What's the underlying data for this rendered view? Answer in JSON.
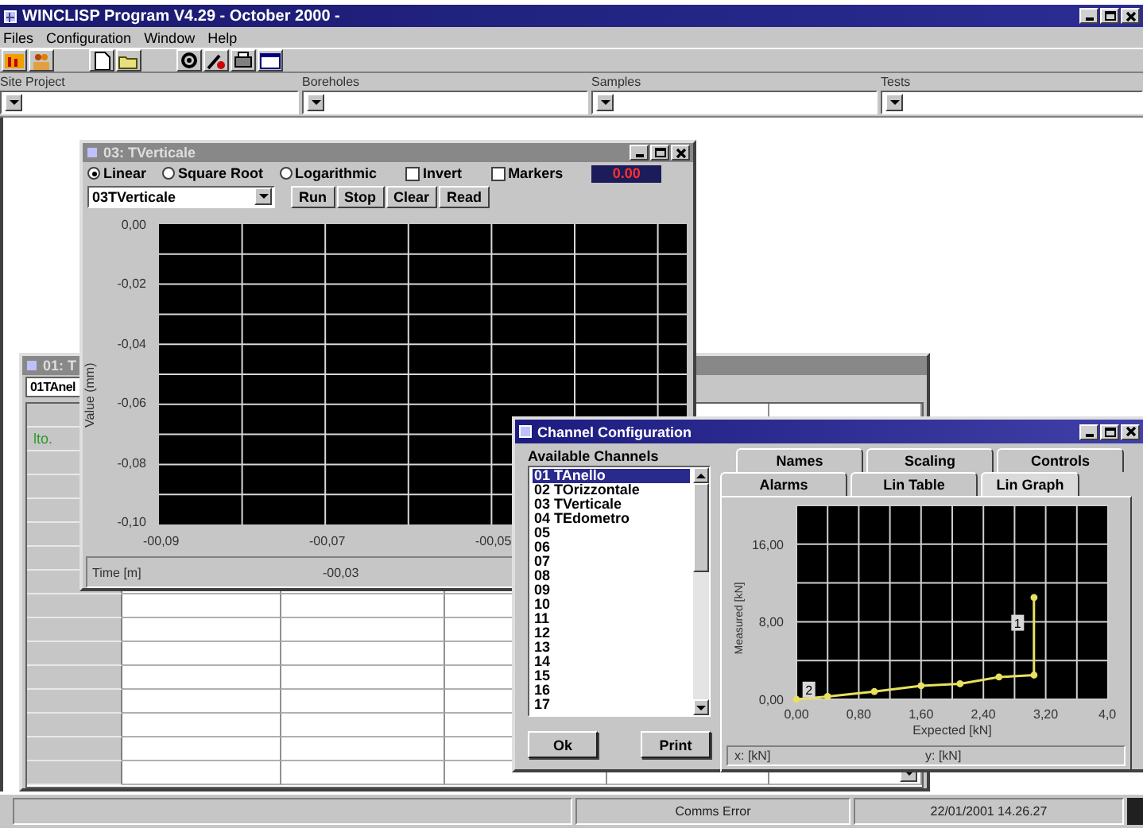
{
  "window": {
    "title": "WINCLISP Program V4.29 - October 2000 -"
  },
  "menu": [
    {
      "label": "Files"
    },
    {
      "label": "Configuration"
    },
    {
      "label": "Window"
    },
    {
      "label": "Help"
    }
  ],
  "selectors": [
    {
      "label": "Site Project"
    },
    {
      "label": "Boreholes"
    },
    {
      "label": "Samples"
    },
    {
      "label": "Tests"
    }
  ],
  "back_window": {
    "title": "01: T",
    "channel": "01TAnel",
    "row_label": "lto."
  },
  "plot_window": {
    "title": "03: TVerticale",
    "scales": [
      {
        "label": "Linear",
        "selected": true
      },
      {
        "label": "Square Root",
        "selected": false
      },
      {
        "label": "Logarithmic",
        "selected": false
      }
    ],
    "options": [
      {
        "label": "Invert",
        "checked": false
      },
      {
        "label": "Markers",
        "checked": false
      }
    ],
    "readout": "0.00",
    "channel": "03TVerticale",
    "buttons": [
      "Run",
      "Stop",
      "Clear",
      "Read"
    ],
    "y_ticks": [
      "0,00",
      "-0,02",
      "-0,04",
      "-0,06",
      "-0,08",
      "-0,10"
    ],
    "y_title": "Value (mm)",
    "x_ticks": [
      "-00,09",
      "-00,07",
      "-00,05"
    ],
    "time_label": "Time [m]",
    "time_value": "-00,03"
  },
  "channel_config": {
    "title": "Channel Configuration",
    "list_title": "Available Channels",
    "channels": [
      {
        "label": "01 TAnello",
        "selected": true
      },
      {
        "label": "02 TOrizzontale",
        "selected": false
      },
      {
        "label": "03 TVerticale",
        "selected": false
      },
      {
        "label": "04 TEdometro",
        "selected": false
      },
      {
        "label": "05",
        "selected": false
      },
      {
        "label": "06",
        "selected": false
      },
      {
        "label": "07",
        "selected": false
      },
      {
        "label": "08",
        "selected": false
      },
      {
        "label": "09",
        "selected": false
      },
      {
        "label": "10",
        "selected": false
      },
      {
        "label": "11",
        "selected": false
      },
      {
        "label": "12",
        "selected": false
      },
      {
        "label": "13",
        "selected": false
      },
      {
        "label": "14",
        "selected": false
      },
      {
        "label": "15",
        "selected": false
      },
      {
        "label": "16",
        "selected": false
      },
      {
        "label": "17",
        "selected": false
      }
    ],
    "tab_rows": [
      [
        {
          "label": "Names",
          "selected": false
        },
        {
          "label": "Scaling",
          "selected": false
        },
        {
          "label": "Controls",
          "selected": false
        }
      ],
      [
        {
          "label": "Alarms",
          "selected": false
        },
        {
          "label": "Lin Table",
          "selected": false
        },
        {
          "label": "Lin Graph",
          "selected": true
        }
      ]
    ],
    "buttons": [
      "Ok",
      "Print"
    ],
    "chart_data": {
      "type": "line",
      "xlabel": "Expected [kN]",
      "ylabel": "Measured [kN]",
      "x": [
        0,
        0.4,
        1.0,
        1.6,
        2.1,
        2.6,
        3.05,
        3.05
      ],
      "grid": true,
      "series": [
        {
          "color": "#e8e060",
          "marker": "circle",
          "values": [
            0,
            0.3,
            0.8,
            1.4,
            1.6,
            2.3,
            2.5,
            10.5
          ]
        }
      ],
      "xlim": [
        0,
        4
      ],
      "ylim": [
        0,
        20
      ],
      "xticks": [
        {
          "value": 0,
          "label": "0,00"
        },
        {
          "value": 0.8,
          "label": "0,80"
        },
        {
          "value": 1.6,
          "label": "1,60"
        },
        {
          "value": 2.4,
          "label": "2,40"
        },
        {
          "value": 3.2,
          "label": "3,20"
        },
        {
          "value": 4,
          "label": "4,0"
        }
      ],
      "yticks": [
        {
          "value": 0,
          "label": "0,00"
        },
        {
          "value": 8,
          "label": "8,00"
        },
        {
          "value": 16,
          "label": "16,00"
        }
      ],
      "annotations": [
        {
          "text": "1",
          "x": 2.84,
          "y": 7.9
        },
        {
          "text": "2",
          "x": 0.16,
          "y": 1.0
        }
      ]
    },
    "readouts": [
      "x: [kN]",
      "y: [kN]"
    ]
  },
  "status_bar": {
    "message": "Comms Error",
    "datetime": "22/01/2001 14.26.27"
  }
}
